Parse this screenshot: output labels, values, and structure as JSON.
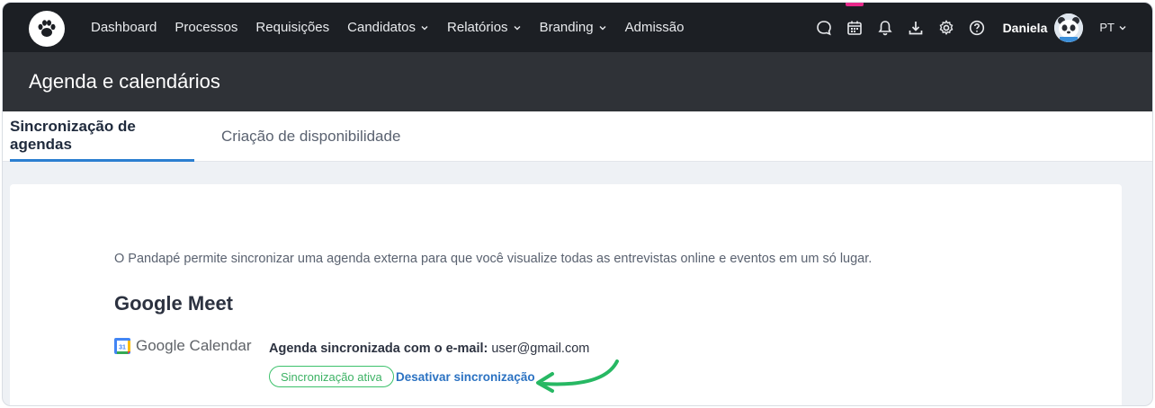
{
  "nav": {
    "items": [
      {
        "label": "Dashboard",
        "dropdown": false
      },
      {
        "label": "Processos",
        "dropdown": false
      },
      {
        "label": "Requisições",
        "dropdown": false
      },
      {
        "label": "Candidatos",
        "dropdown": true
      },
      {
        "label": "Relatórios",
        "dropdown": true
      },
      {
        "label": "Branding",
        "dropdown": true
      },
      {
        "label": "Admissão",
        "dropdown": false
      }
    ],
    "user_name": "Daniela",
    "language": "PT",
    "icons": [
      "chat-icon",
      "calendar-icon",
      "bell-icon",
      "download-icon",
      "gear-icon",
      "help-icon"
    ],
    "accent_color": "#e8288a"
  },
  "header": {
    "title": "Agenda e calendários"
  },
  "tabs": [
    {
      "label": "Sincronização de agendas",
      "active": true
    },
    {
      "label": "Criação de disponibilidade",
      "active": false
    }
  ],
  "content": {
    "intro": "O Pandapé permite sincronizar uma agenda externa para que você visualize todas as entrevistas online e eventos em um só lugar.",
    "section_title": "Google Meet",
    "provider": "Google Calendar",
    "calendar_day": "31",
    "sync_label": "Agenda sincronizada com o e-mail:",
    "email": "user@gmail.com",
    "status_badge": "Sincronização ativa",
    "deactivate_link": "Desativar sincronização",
    "status_color": "#3cc16b",
    "link_color": "#2b72c2"
  }
}
